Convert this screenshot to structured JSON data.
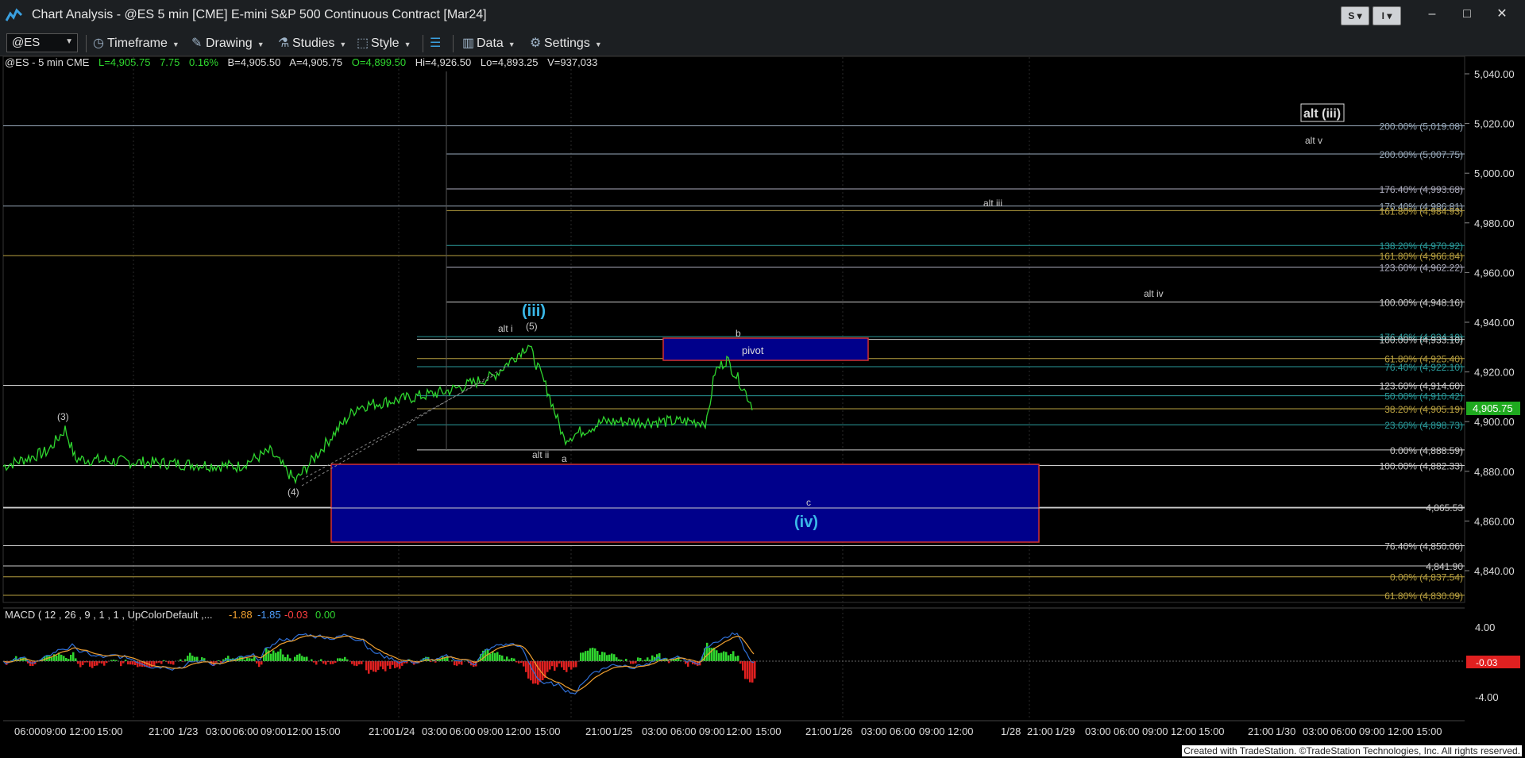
{
  "window": {
    "title": "Chart Analysis - @ES 5 min [CME] E-mini S&P 500 Continuous Contract [Mar24]",
    "btn_s": "S",
    "btn_i": "I",
    "minimize": "–",
    "maximize": "□",
    "close": "✕"
  },
  "toolbar": {
    "symbol": "@ES",
    "timeframe": "Timeframe",
    "drawing": "Drawing",
    "studies": "Studies",
    "style": "Style",
    "data": "Data",
    "settings": "Settings"
  },
  "infobar": {
    "symbol": "@ES - 5 min  CME",
    "last": "L=4,905.75",
    "change": "7.75",
    "pct": "0.16%",
    "bid": "B=4,905.50",
    "ask": "A=4,905.75",
    "open": "O=4,899.50",
    "high": "Hi=4,926.50",
    "low": "Lo=4,893.25",
    "volume": "V=937,033"
  },
  "colors": {
    "price": "#2fd62f",
    "macd_line": "#2f6fd6",
    "macd_signal": "#f0a030",
    "box": "#00008b",
    "box_border": "#d23030"
  },
  "price_axis": {
    "ticks": [
      "5,040.00",
      "5,020.00",
      "5,000.00",
      "4,980.00",
      "4,960.00",
      "4,940.00",
      "4,920.00",
      "4,900.00",
      "4,880.00",
      "4,860.00",
      "4,840.00"
    ],
    "current": "4,905.75"
  },
  "macd": {
    "label": "MACD ( 12 , 26 , 9 , 1 , 1 , UpColorDefault ,...",
    "v1": "-1.88",
    "v2": "-1.85",
    "v3": "-0.03",
    "v4": "0.00",
    "axis_top": "4.00",
    "axis_bottom": "-4.00",
    "current": "-0.03"
  },
  "time_axis": [
    "06:00",
    "09:00",
    "12:00",
    "15:00",
    "21:00",
    "1/23",
    "03:00",
    "06:00",
    "09:00",
    "12:00",
    "15:00",
    "21:00",
    "1/24",
    "03:00",
    "06:00",
    "09:00",
    "12:00",
    "15:00",
    "21:00",
    "1/25",
    "03:00",
    "06:00",
    "09:00",
    "12:00",
    "15:00",
    "21:00",
    "1/26",
    "03:00",
    "06:00",
    "09:00",
    "12:00",
    "1/28",
    "21:00",
    "1/29",
    "03:00",
    "06:00",
    "09:00",
    "12:00",
    "15:00",
    "21:00",
    "1/30",
    "03:00",
    "06:00",
    "09:00",
    "12:00",
    "15:00"
  ],
  "fib_labels": [
    "200.00% (5,019.08)",
    "200.00% (5,007.75)",
    "176.40% (4,993.68)",
    "176.40% (4,986.81)",
    "161.80% (4,984.93)",
    "138.20% (4,970.92)",
    "161.80% (4,966.84)",
    "123.60% (4,962.22)",
    "100.00% (4,948.16)",
    "176.40% (4,934.19)",
    "100.00% (4,933.10)",
    "61.80% (4,925.40)",
    "76.40% (4,922.10)",
    "123.60% (4,914.60)",
    "50.00% (4,910.42)",
    "38.20% (4,905.19)",
    "23.60% (4,898.73)",
    "0.00% (4,888.59)",
    "100.00% (4,882.33)",
    "4,865.53",
    "76.40% (4,850.06)",
    "4,841.90",
    "0.00% (4,837.54)",
    "61.80% (4,830.09)"
  ],
  "annotations": {
    "alt_iii_boxed": "alt (iii)",
    "alt_v": "alt v",
    "alt_iii": "alt iii",
    "alt_iv": "alt iv",
    "wave_iii": "(iii)",
    "alt_i": "alt i",
    "wave_5": "(5)",
    "wave_3": "(3)",
    "wave_4": "(4)",
    "alt_ii": "alt ii",
    "wave_a": "a",
    "wave_b": "b",
    "wave_c": "c",
    "pivot": "pivot",
    "wave_iv": "(iv)"
  },
  "footer": "Created with TradeStation. ©TradeStation Technologies, Inc. All rights reserved."
}
